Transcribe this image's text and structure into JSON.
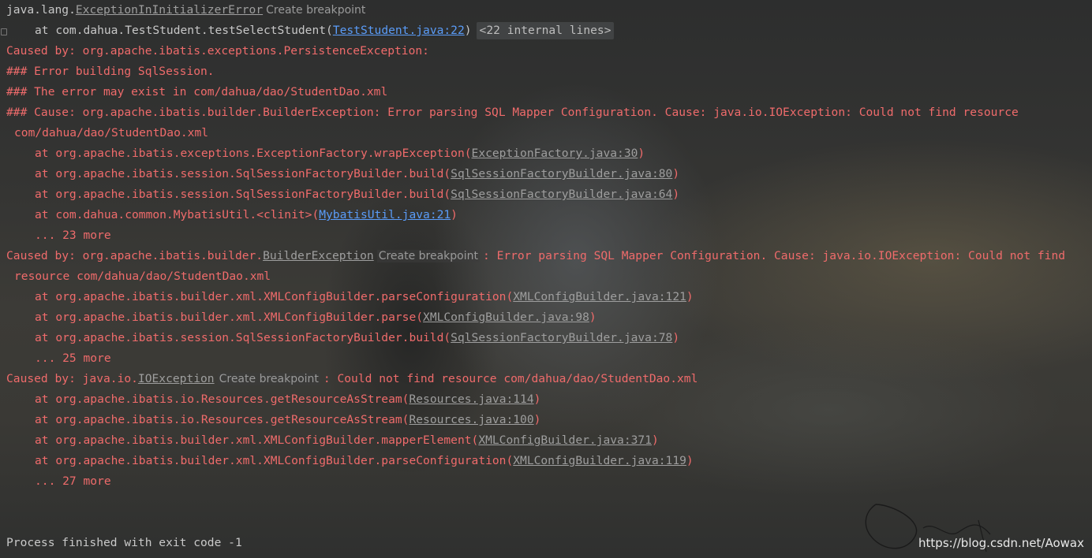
{
  "console": {
    "line1": {
      "prefix": "java.lang.",
      "link": "ExceptionInInitializerError",
      "hint": "Create breakpoint"
    },
    "line2": {
      "prefix": "at com.dahua.TestStudent.testSelectStudent(",
      "link": "TestStudent.java:22",
      "suffix": ")",
      "internal": "<22 internal lines>"
    },
    "line3": "Caused by: org.apache.ibatis.exceptions.PersistenceException:",
    "line4": "### Error building SqlSession.",
    "line5": "### The error may exist in com/dahua/dao/StudentDao.xml",
    "line6": "### Cause: org.apache.ibatis.builder.BuilderException: Error parsing SQL Mapper Configuration. Cause: java.io.IOException: Could not find resource",
    "line7": "com/dahua/dao/StudentDao.xml",
    "line8": {
      "prefix": "at org.apache.ibatis.exceptions.ExceptionFactory.wrapException(",
      "link": "ExceptionFactory.java:30",
      "suffix": ")"
    },
    "line9": {
      "prefix": "at org.apache.ibatis.session.SqlSessionFactoryBuilder.build(",
      "link": "SqlSessionFactoryBuilder.java:80",
      "suffix": ")"
    },
    "line10": {
      "prefix": "at org.apache.ibatis.session.SqlSessionFactoryBuilder.build(",
      "link": "SqlSessionFactoryBuilder.java:64",
      "suffix": ")"
    },
    "line11": {
      "prefix": "at com.dahua.common.MybatisUtil.<clinit>(",
      "link": "MybatisUtil.java:21",
      "suffix": ")"
    },
    "line12": "... 23 more",
    "line13": {
      "prefix": "Caused by: org.apache.ibatis.builder.",
      "link": "BuilderException",
      "hint": "Create breakpoint",
      "suffix": ": Error parsing SQL Mapper Configuration. Cause: java.io.IOException: Could not find"
    },
    "line14": "resource com/dahua/dao/StudentDao.xml",
    "line15": {
      "prefix": "at org.apache.ibatis.builder.xml.XMLConfigBuilder.parseConfiguration(",
      "link": "XMLConfigBuilder.java:121",
      "suffix": ")"
    },
    "line16": {
      "prefix": "at org.apache.ibatis.builder.xml.XMLConfigBuilder.parse(",
      "link": "XMLConfigBuilder.java:98",
      "suffix": ")"
    },
    "line17": {
      "prefix": "at org.apache.ibatis.session.SqlSessionFactoryBuilder.build(",
      "link": "SqlSessionFactoryBuilder.java:78",
      "suffix": ")"
    },
    "line18": "... 25 more",
    "line19": {
      "prefix": "Caused by: java.io.",
      "link": "IOException",
      "hint": "Create breakpoint",
      "suffix": ": Could not find resource com/dahua/dao/StudentDao.xml"
    },
    "line20": {
      "prefix": "at org.apache.ibatis.io.Resources.getResourceAsStream(",
      "link": "Resources.java:114",
      "suffix": ")"
    },
    "line21": {
      "prefix": "at org.apache.ibatis.io.Resources.getResourceAsStream(",
      "link": "Resources.java:100",
      "suffix": ")"
    },
    "line22": {
      "prefix": "at org.apache.ibatis.builder.xml.XMLConfigBuilder.mapperElement(",
      "link": "XMLConfigBuilder.java:371",
      "suffix": ")"
    },
    "line23": {
      "prefix": "at org.apache.ibatis.builder.xml.XMLConfigBuilder.parseConfiguration(",
      "link": "XMLConfigBuilder.java:119",
      "suffix": ")"
    },
    "line24": "... 27 more",
    "process": "Process finished with exit code -1"
  },
  "watermark": "https://blog.csdn.net/Aowax",
  "colors": {
    "error": "#ef6b6b",
    "link_blue": "#5a9cf8",
    "link_gray": "#9e9e9e",
    "text": "#c7c7c7"
  }
}
